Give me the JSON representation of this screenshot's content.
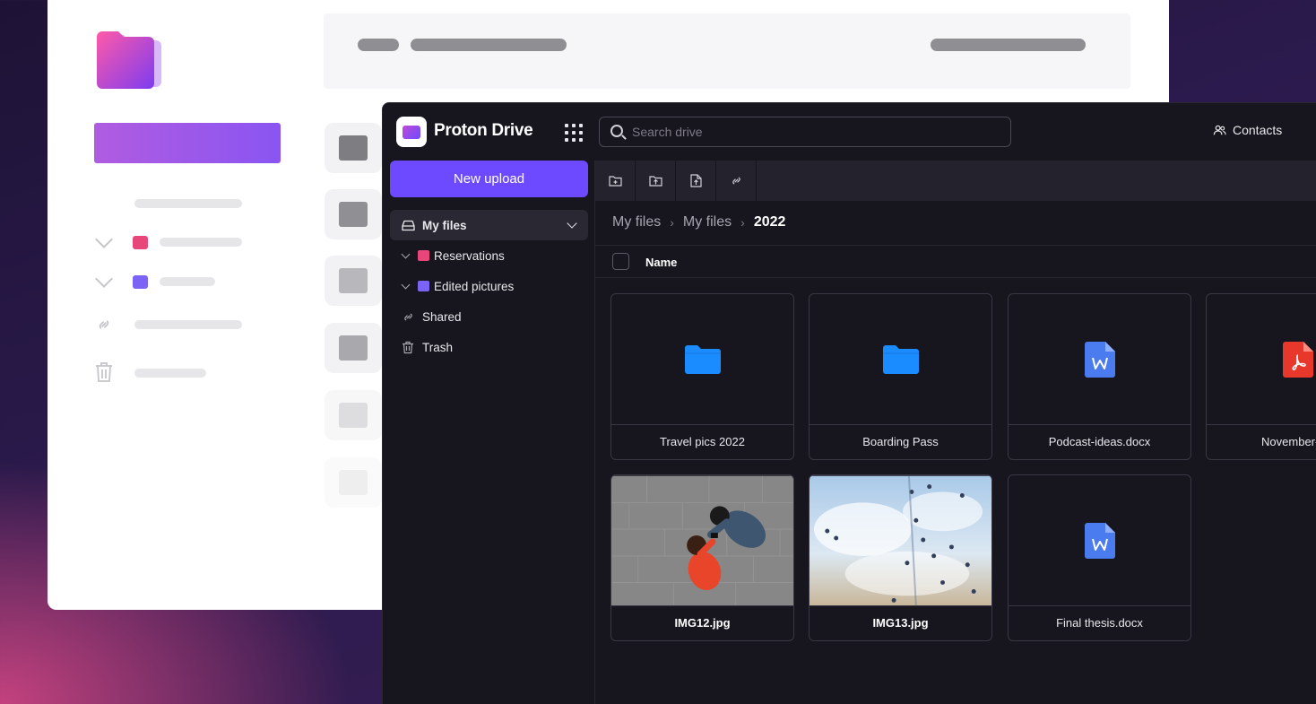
{
  "brand": {
    "name": "Proton Drive"
  },
  "search": {
    "placeholder": "Search drive"
  },
  "header": {
    "contacts_label": "Contacts"
  },
  "sidebar": {
    "new_upload_label": "New upload",
    "items": [
      {
        "label": "My files",
        "icon": "drive-icon"
      },
      {
        "label": "Reservations",
        "icon": "folder-icon",
        "color": "#e8457a"
      },
      {
        "label": "Edited pictures",
        "icon": "folder-icon",
        "color": "#7a63f5"
      },
      {
        "label": "Shared",
        "icon": "link-icon"
      },
      {
        "label": "Trash",
        "icon": "trash-icon"
      }
    ]
  },
  "toolbar": {
    "buttons": [
      "new-folder-icon",
      "upload-folder-icon",
      "upload-file-icon",
      "share-link-icon"
    ]
  },
  "breadcrumb": [
    "My files",
    "My files",
    "2022"
  ],
  "list": {
    "column_name": "Name"
  },
  "files": [
    {
      "name": "Travel pics 2022",
      "type": "folder"
    },
    {
      "name": "Boarding Pass",
      "type": "folder"
    },
    {
      "name": "Podcast-ideas.docx",
      "type": "docx"
    },
    {
      "name": "November-inv",
      "type": "pdf"
    },
    {
      "name": "IMG12.jpg",
      "type": "image"
    },
    {
      "name": "IMG13.jpg",
      "type": "image"
    },
    {
      "name": "Final thesis.docx",
      "type": "docx"
    }
  ],
  "colors": {
    "accent": "#6d4aff",
    "folder": "#1a8cff",
    "word": "#4a7cf0",
    "pdf": "#e8372b",
    "dark_bg": "#17151d"
  }
}
